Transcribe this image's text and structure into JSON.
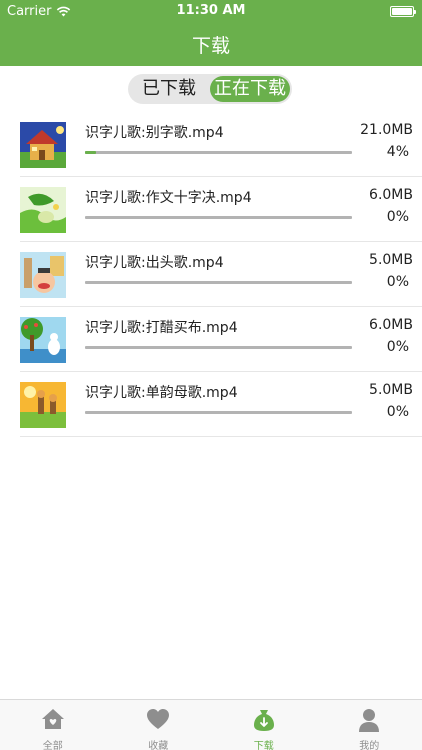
{
  "status_bar": {
    "carrier": "Carrier",
    "time": "11:30 AM"
  },
  "nav": {
    "title": "下载"
  },
  "segment": {
    "options": [
      "已下载",
      "正在下载"
    ],
    "selected_index": 1
  },
  "downloads": [
    {
      "title": "识字儿歌:别字歌.mp4",
      "size": "21.0MB",
      "percent": "4%",
      "progress": 0.04
    },
    {
      "title": "识字儿歌:作文十字决.mp4",
      "size": "6.0MB",
      "percent": "0%",
      "progress": 0
    },
    {
      "title": "识字儿歌:出头歌.mp4",
      "size": "5.0MB",
      "percent": "0%",
      "progress": 0
    },
    {
      "title": "识字儿歌:打醋买布.mp4",
      "size": "6.0MB",
      "percent": "0%",
      "progress": 0
    },
    {
      "title": "识字儿歌:单韵母歌.mp4",
      "size": "5.0MB",
      "percent": "0%",
      "progress": 0
    }
  ],
  "tab_bar": {
    "tabs": [
      {
        "label": "全部",
        "icon": "home-icon"
      },
      {
        "label": "收藏",
        "icon": "heart-icon"
      },
      {
        "label": "下载",
        "icon": "download-bag-icon"
      },
      {
        "label": "我的",
        "icon": "person-icon"
      }
    ],
    "active_index": 2
  },
  "colors": {
    "accent": "#6ab04c",
    "segment_bg": "#e6e6e6",
    "track": "#b3b3b3",
    "tab_inactive": "#8e8e8e"
  }
}
